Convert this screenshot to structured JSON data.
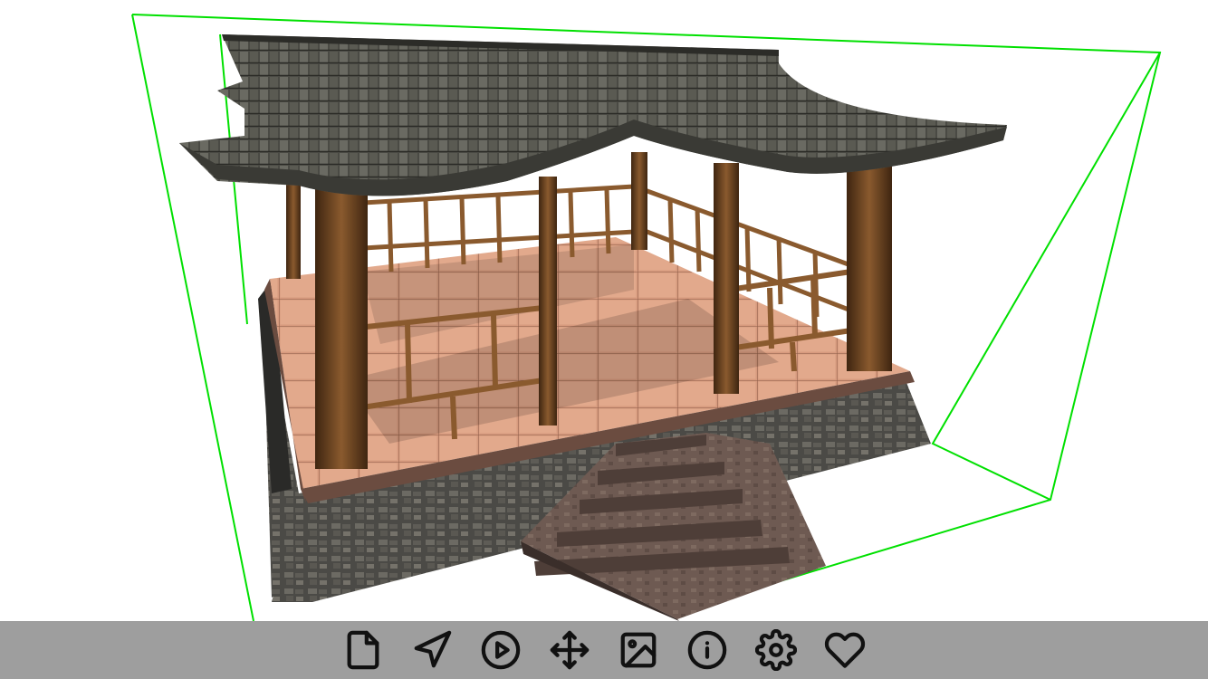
{
  "viewer": {
    "bounding_box_color": "#00e000",
    "model": "japanese-pavilion"
  },
  "toolbar": {
    "background": "#9e9e9e",
    "buttons": [
      {
        "id": "file",
        "icon": "file-icon"
      },
      {
        "id": "navigate",
        "icon": "navigation-arrow-icon"
      },
      {
        "id": "play",
        "icon": "play-circle-icon"
      },
      {
        "id": "move",
        "icon": "move-arrows-icon"
      },
      {
        "id": "image",
        "icon": "image-icon"
      },
      {
        "id": "info",
        "icon": "info-icon"
      },
      {
        "id": "settings",
        "icon": "gear-icon"
      },
      {
        "id": "favorite",
        "icon": "heart-icon"
      }
    ]
  }
}
